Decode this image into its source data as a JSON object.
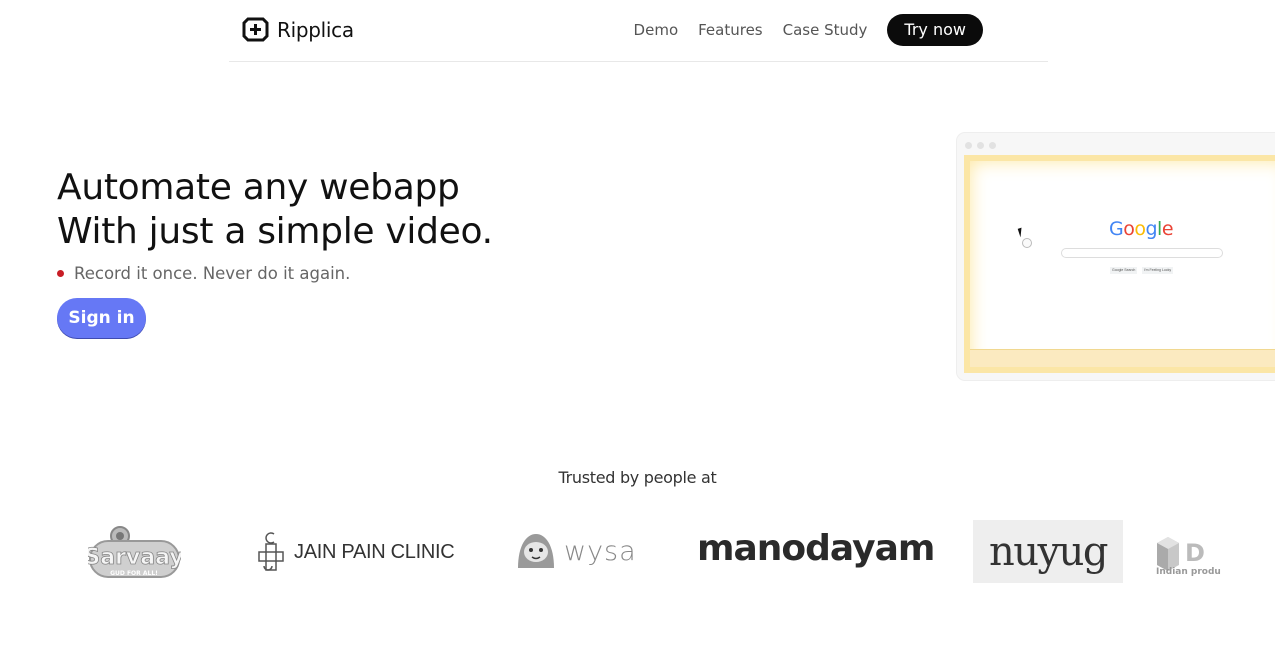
{
  "header": {
    "brand_name": "Ripplica",
    "nav": [
      "Demo",
      "Features",
      "Case Study"
    ],
    "cta_label": "Try now"
  },
  "hero": {
    "title_line1": "Automate any webapp",
    "title_line2": "With just a simple video.",
    "tagline": "Record it once. Never do it again.",
    "signin_label": "Sign in"
  },
  "preview": {
    "google_letters": [
      "G",
      "o",
      "o",
      "g",
      "l",
      "e"
    ],
    "search_button": "Google Search",
    "lucky_button": "I'm Feeling Lucky"
  },
  "trusted": {
    "heading": "Trusted by people at",
    "logos": {
      "sarvaay": "Sarvaay",
      "sarvaay_sub": "GUD FOR ALL!",
      "jain": "JAIN PAIN CLINIC",
      "wysa": "wysa",
      "manodayam": "manodayam",
      "nuyug": "nuyug",
      "indian_big": "D",
      "indian_small": "Indian produ"
    }
  },
  "colors": {
    "cta_bg": "#0b0b0b",
    "signin_bg": "#6678f5",
    "tagline_dot": "#c81d25",
    "preview_glow": "#fbe6a6"
  }
}
